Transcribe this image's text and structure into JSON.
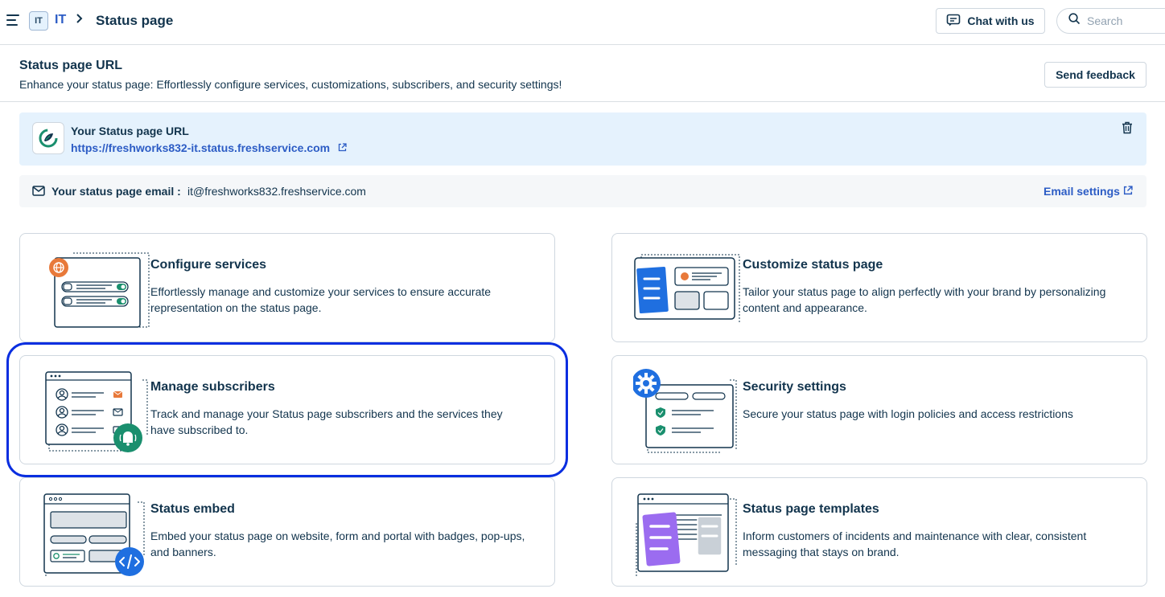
{
  "topbar": {
    "workspace_badge": "IT",
    "workspace_name": "IT",
    "breadcrumb_separator": ">",
    "current_page": "Status page",
    "chat_label": "Chat with us",
    "search_placeholder": "Search"
  },
  "header": {
    "title": "Status page URL",
    "subtitle": "Enhance your status page: Effortlessly configure services, customizations, subscribers, and security settings!",
    "feedback_label": "Send feedback"
  },
  "url_panel": {
    "label": "Your Status page URL",
    "url": "https://freshworks832-it.status.freshservice.com"
  },
  "email_panel": {
    "label": "Your status page email :",
    "value": "it@freshworks832.freshservice.com",
    "settings_label": "Email settings"
  },
  "cards": [
    {
      "title": "Configure services",
      "description": "Effortlessly manage and customize your services to ensure accurate representation on the status page.",
      "icon": "services-illustration"
    },
    {
      "title": "Customize status page",
      "description": "Tailor your status page to align perfectly with your brand by personalizing content and appearance.",
      "icon": "customize-illustration"
    },
    {
      "title": "Manage subscribers",
      "description": "Track and manage your Status page subscribers and the services they have subscribed to.",
      "icon": "subscribers-illustration"
    },
    {
      "title": "Security settings",
      "description": "Secure your status page with login policies and access restrictions",
      "icon": "security-illustration"
    },
    {
      "title": "Status embed",
      "description": "Embed your status page on website, form and portal with badges, pop-ups, and banners.",
      "icon": "embed-illustration"
    },
    {
      "title": "Status page templates",
      "description": "Inform customers of incidents and maintenance with clear, consistent messaging that stays on brand.",
      "icon": "templates-illustration"
    }
  ],
  "colors": {
    "link": "#2c5cc5",
    "text": "#12344d",
    "url_panel_bg": "#e5f2fd",
    "email_panel_bg": "#f5f7f9",
    "selection_outline": "#0a2ee0",
    "accent_orange": "#e8793a",
    "accent_green": "#1a8f6e",
    "accent_blue": "#1f6fe0",
    "accent_purple": "#9b6cf0"
  }
}
